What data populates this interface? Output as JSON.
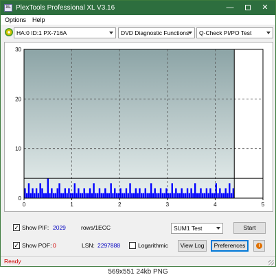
{
  "window": {
    "title": "PlexTools Professional XL V3.16",
    "icon_text": "XL",
    "controls": {
      "minimize": "—",
      "close": "✕"
    }
  },
  "menu": {
    "options": "Options",
    "help": "Help"
  },
  "toolbar": {
    "drive": "HA:0 ID:1  PX-716A",
    "function": "DVD Diagnostic Functions",
    "test": "Q-Check PI/PO Test"
  },
  "chart_data": {
    "type": "bar",
    "x_ticks": [
      "0",
      "1",
      "2",
      "3",
      "4",
      "5"
    ],
    "y_ticks": [
      "0",
      "10",
      "20",
      "30"
    ],
    "xlim": [
      0,
      5
    ],
    "ylim": [
      0,
      30
    ],
    "grid": true,
    "threshold": 4,
    "scan_end_x": 4.4,
    "bar_color": "#0000ff",
    "series": [
      {
        "x": [
          0.02,
          0.06,
          0.1,
          0.14,
          0.18,
          0.22,
          0.26,
          0.3,
          0.34,
          0.38,
          0.42,
          0.46,
          0.5,
          0.54,
          0.58,
          0.62,
          0.66,
          0.7,
          0.74,
          0.78,
          0.82,
          0.86,
          0.9,
          0.94,
          0.98,
          1.02,
          1.06,
          1.1,
          1.14,
          1.18,
          1.22,
          1.26,
          1.3,
          1.34,
          1.38,
          1.42,
          1.46,
          1.5,
          1.54,
          1.58,
          1.62,
          1.66,
          1.7,
          1.74,
          1.78,
          1.82,
          1.86,
          1.9,
          1.94,
          1.98,
          2.02,
          2.06,
          2.1,
          2.14,
          2.18,
          2.22,
          2.26,
          2.3,
          2.34,
          2.38,
          2.42,
          2.46,
          2.5,
          2.54,
          2.58,
          2.62,
          2.66,
          2.7,
          2.74,
          2.78,
          2.82,
          2.86,
          2.9,
          2.94,
          2.98,
          3.02,
          3.06,
          3.1,
          3.14,
          3.18,
          3.22,
          3.26,
          3.3,
          3.34,
          3.38,
          3.42,
          3.46,
          3.5,
          3.54,
          3.58,
          3.62,
          3.66,
          3.7,
          3.74,
          3.78,
          3.82,
          3.86,
          3.9,
          3.94,
          3.98,
          4.02,
          4.06,
          4.1,
          4.14,
          4.18,
          4.22,
          4.26,
          4.3,
          4.34,
          4.38
        ],
        "values": [
          2,
          1,
          3,
          1,
          2,
          1,
          2,
          1,
          3,
          2,
          1,
          1,
          4,
          1,
          2,
          1,
          1,
          2,
          3,
          1,
          1,
          2,
          1,
          2,
          1,
          1,
          3,
          1,
          2,
          1,
          1,
          2,
          1,
          1,
          2,
          1,
          3,
          1,
          1,
          2,
          1,
          1,
          2,
          1,
          1,
          3,
          1,
          2,
          1,
          1,
          2,
          1,
          1,
          2,
          1,
          3,
          1,
          1,
          2,
          1,
          2,
          1,
          1,
          2,
          1,
          1,
          3,
          1,
          2,
          1,
          1,
          2,
          1,
          1,
          2,
          1,
          1,
          3,
          1,
          2,
          1,
          1,
          2,
          1,
          1,
          2,
          1,
          2,
          1,
          3,
          1,
          1,
          2,
          1,
          1,
          2,
          1,
          2,
          1,
          1,
          3,
          1,
          2,
          1,
          1,
          2,
          1,
          3,
          1,
          2
        ]
      }
    ]
  },
  "panel": {
    "show_pif_label": "Show PIF:",
    "pif_value": "2029",
    "pif_unit": "rows/1ECC",
    "show_pof_label": "Show POF:",
    "pof_value": "0",
    "lsn_label": "LSN:",
    "lsn_value": "2297888",
    "logarithmic_label": "Logarithmic",
    "sum_test": "SUM1 Test",
    "start_button": "Start",
    "view_log_button": "View Log",
    "preferences_button": "Preferences",
    "check_mark": "✓",
    "info_glyph": "i"
  },
  "status": {
    "text": "Ready"
  },
  "caption": "569x551  24kb  PNG",
  "colors": {
    "titlebar": "#2d6e3e",
    "plot_top": "#8ca4a6",
    "plot_bottom": "#eaf1f0",
    "bar": "#0000ff",
    "status_text": "#d00000"
  }
}
